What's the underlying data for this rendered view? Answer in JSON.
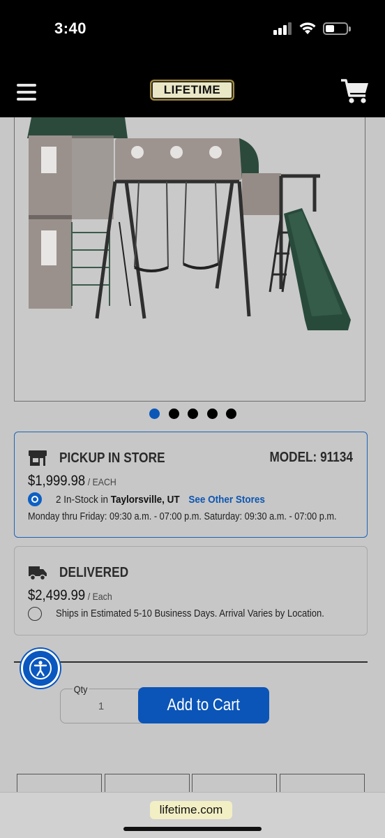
{
  "status_bar": {
    "time": "3:40"
  },
  "header": {
    "logo_text": "LIFETIME",
    "menu_icon": "hamburger-menu-icon",
    "cart_icon": "shopping-cart-icon"
  },
  "gallery": {
    "slide_count": 5,
    "active_index": 0
  },
  "pickup": {
    "title": "PICKUP IN STORE",
    "model": "MODEL: 91134",
    "price": "$1,999.98",
    "unit": "/ EACH",
    "stock_prefix": "2 In-Stock in",
    "store": "Taylorsville, UT",
    "see_other_stores": "See Other Stores",
    "hours": "Monday thru Friday: 09:30 a.m. - 07:00 p.m. Saturday: 09:30 a.m. - 07:00 p.m.",
    "selected": true
  },
  "delivered": {
    "title": "DELIVERED",
    "price": "$2,499.99",
    "unit": "/ Each",
    "ships_text": "Ships in Estimated 5-10 Business Days. Arrival Varies by Location.",
    "selected": false
  },
  "purchase": {
    "qty_label": "Qty",
    "qty_value": "1",
    "add_to_cart": "Add to Cart"
  },
  "browser": {
    "url": "lifetime.com"
  },
  "colors": {
    "accent": "#0b55b8",
    "background": "#c7c7c7",
    "bar": "#000000"
  }
}
